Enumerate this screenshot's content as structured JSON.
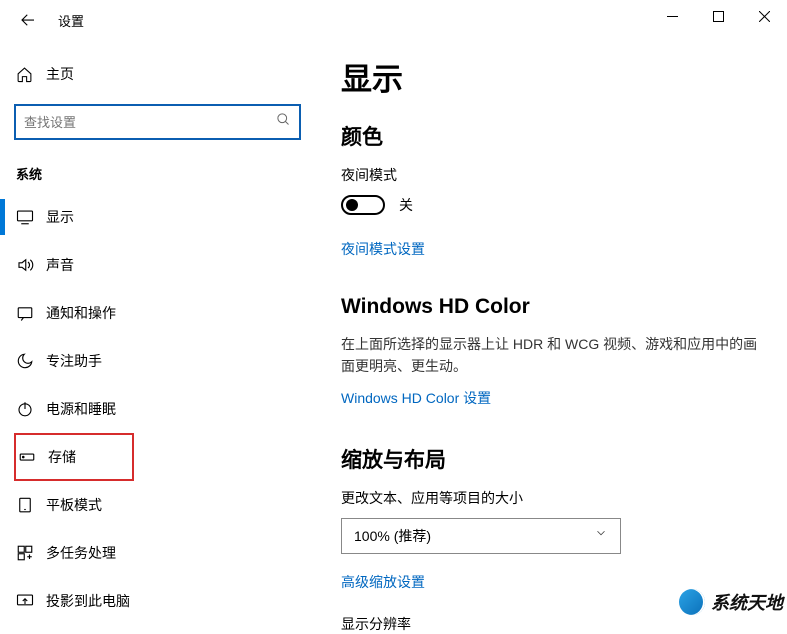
{
  "titlebar": {
    "title": "设置"
  },
  "sidebar": {
    "home_label": "主页",
    "search_placeholder": "查找设置",
    "section_label": "系统",
    "items": [
      {
        "label": "显示"
      },
      {
        "label": "声音"
      },
      {
        "label": "通知和操作"
      },
      {
        "label": "专注助手"
      },
      {
        "label": "电源和睡眠"
      },
      {
        "label": "存储"
      },
      {
        "label": "平板模式"
      },
      {
        "label": "多任务处理"
      },
      {
        "label": "投影到此电脑"
      }
    ]
  },
  "main": {
    "page_title": "显示",
    "color_heading": "颜色",
    "night_light_label": "夜间模式",
    "night_light_state": "关",
    "night_light_settings_link": "夜间模式设置",
    "hd_color_heading": "Windows HD Color",
    "hd_color_desc": "在上面所选择的显示器上让 HDR 和 WCG 视频、游戏和应用中的画面更明亮、更生动。",
    "hd_color_link": "Windows HD Color 设置",
    "scale_heading": "缩放与布局",
    "scale_label": "更改文本、应用等项目的大小",
    "scale_value": "100% (推荐)",
    "advanced_scale_link": "高级缩放设置",
    "resolution_label": "显示分辨率"
  },
  "watermark": {
    "text": "系统天地"
  }
}
